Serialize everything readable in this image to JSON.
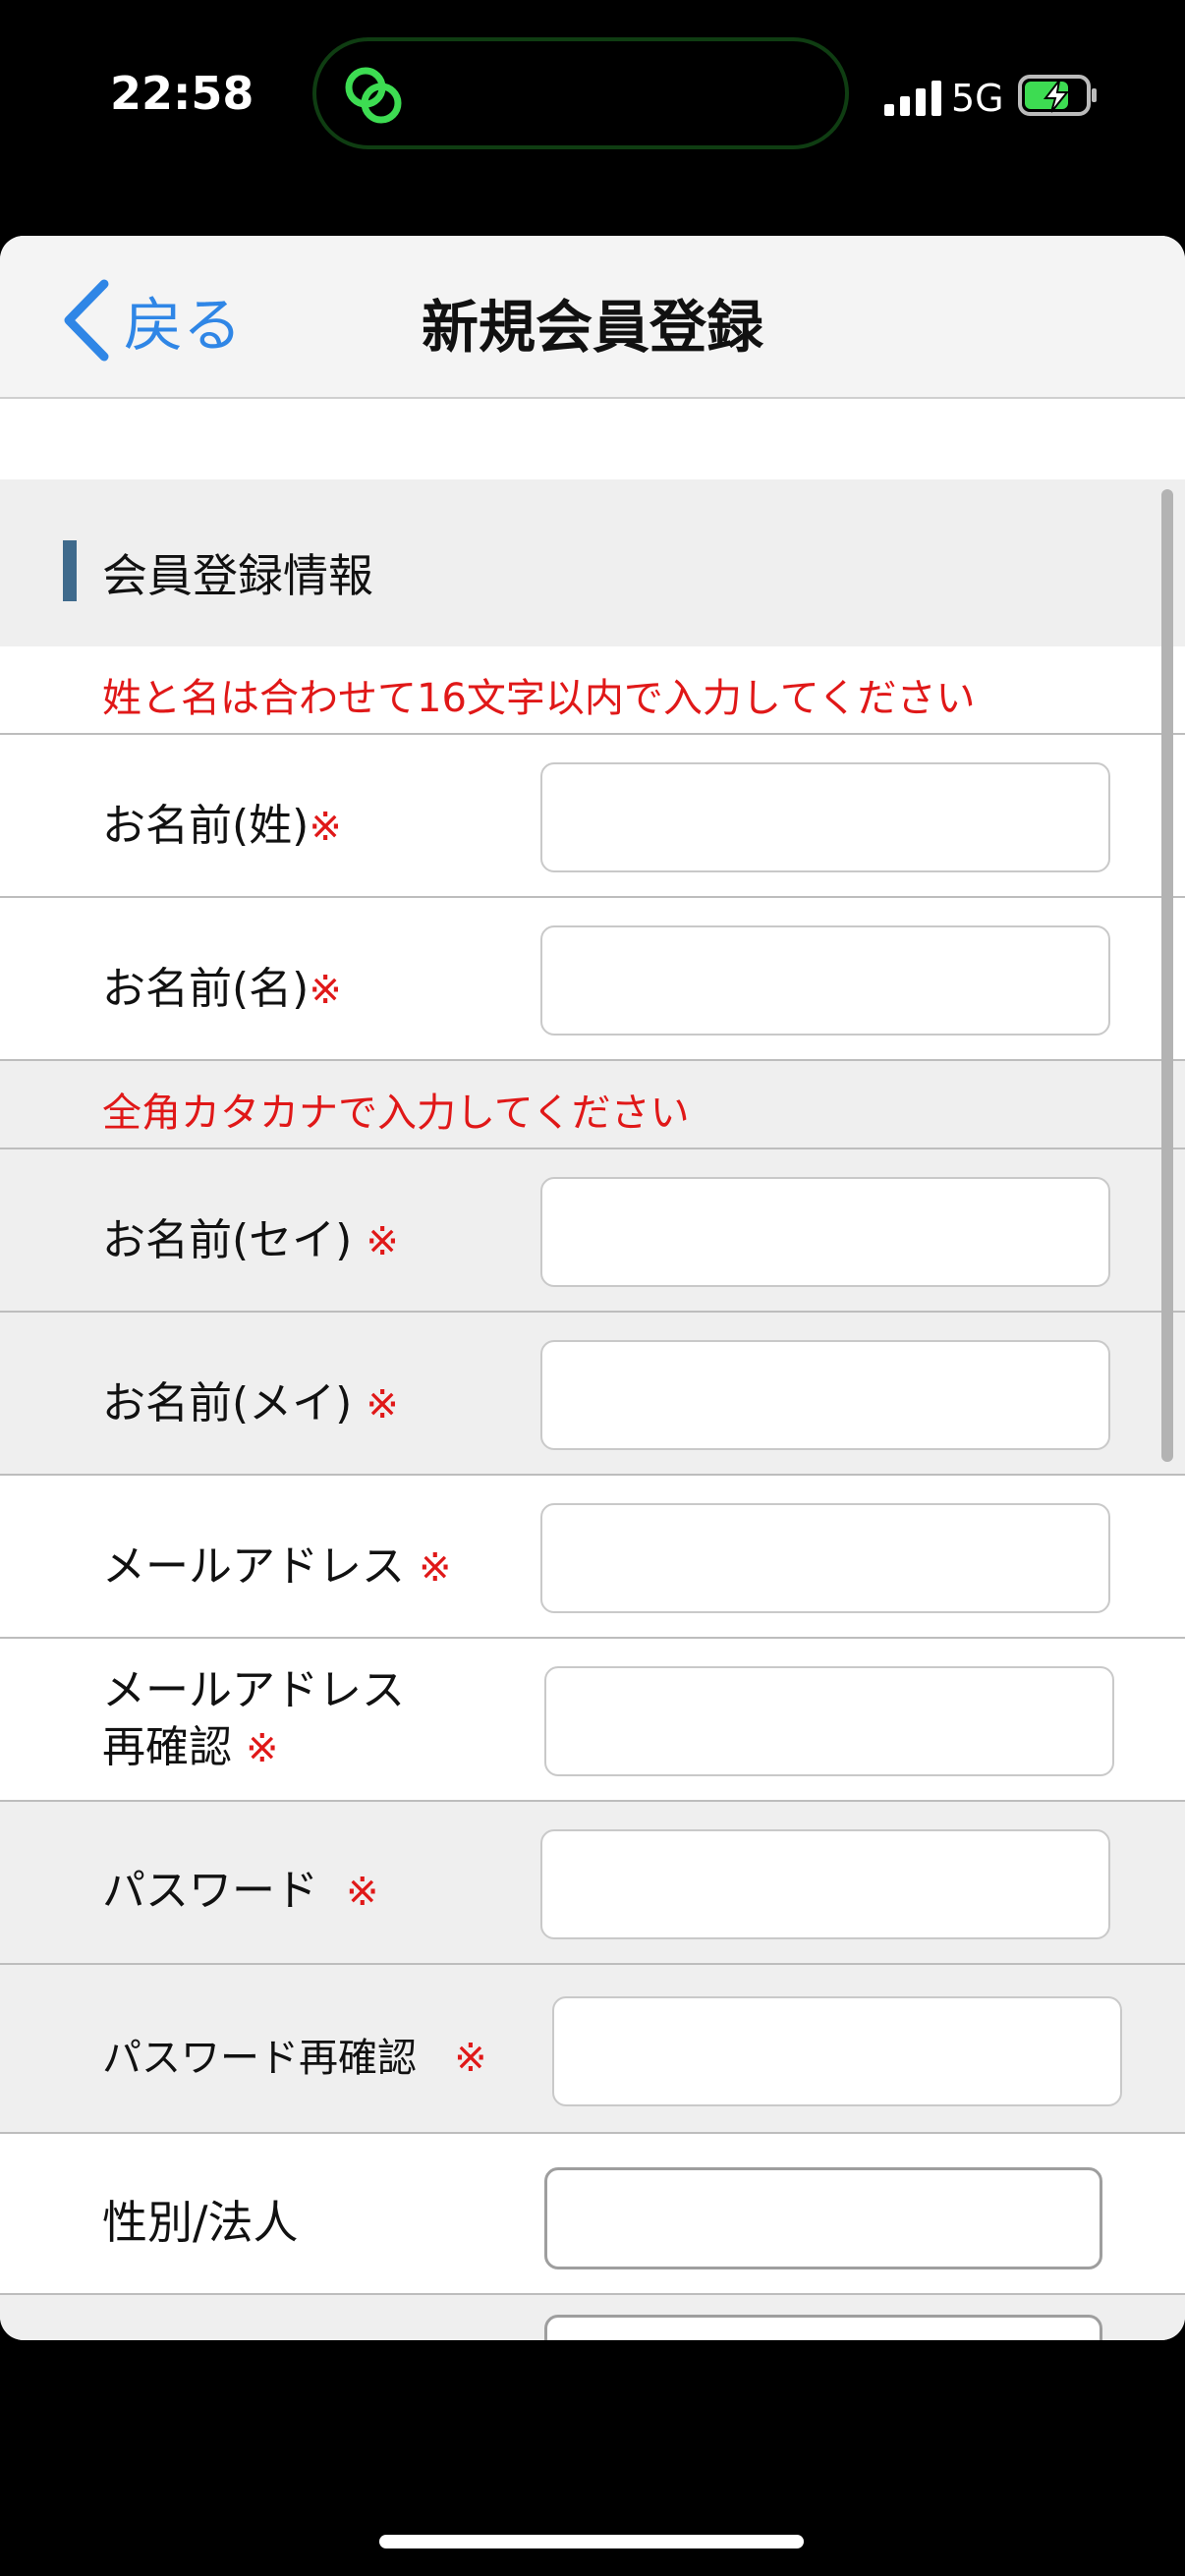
{
  "status": {
    "time": "22:58",
    "network": "5G"
  },
  "nav": {
    "back_label": "戻る",
    "title": "新規会員登録"
  },
  "form": {
    "section_title": "会員登録情報",
    "required_mark": "※",
    "note_name": "姓と名は合わせて16文字以内で入力してください",
    "note_kana": "全角カタカナで入力してください",
    "labels": {
      "last_name": "お名前(姓)",
      "first_name": "お名前(名)",
      "last_name_kana": "お名前(セイ)",
      "first_name_kana": "お名前(メイ)",
      "email": "メールアドレス",
      "email_confirm_1": "メールアドレス",
      "email_confirm_2": "再確認",
      "password": "パスワード",
      "password_confirm": "パスワード再確認",
      "gender": "性別/法人"
    }
  }
}
